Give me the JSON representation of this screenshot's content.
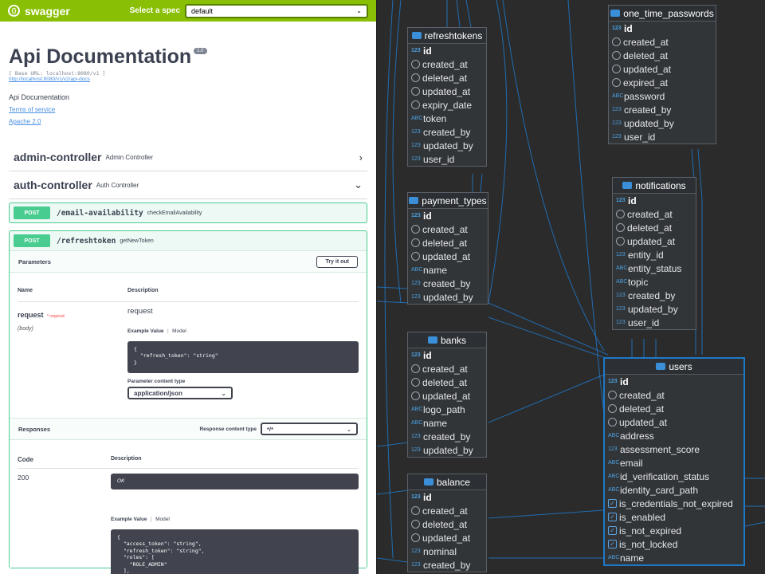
{
  "swagger": {
    "logo": "swagger",
    "select_label": "Select a spec",
    "select_value": "default",
    "title": "Api Documentation",
    "version": "1.0",
    "base_url": "[ Base URL: localhost:8080/v1 ]",
    "docs_link": "http://localhost:8080/v1/v2/api-docs",
    "description": "Api Documentation",
    "terms": "Terms of service",
    "license": "Apache 2.0",
    "controllers": [
      {
        "name": "admin-controller",
        "desc": "Admin Controller",
        "arrow": "›"
      },
      {
        "name": "auth-controller",
        "desc": "Auth Controller",
        "arrow": "⌄"
      }
    ],
    "op1": {
      "method": "POST",
      "path": "/email-availability",
      "summary": "checkEmailAvailability"
    },
    "op2": {
      "method": "POST",
      "path": "/refreshtoken",
      "summary": "getNewToken"
    },
    "parameters_label": "Parameters",
    "try_label": "Try it out",
    "name_col": "Name",
    "desc_col": "Description",
    "param_name": "request",
    "param_required": "* required",
    "param_in": "(body)",
    "param_desc": "request",
    "example_value": "Example Value",
    "model": "Model",
    "example_body": "{\n  \"refresh_token\": \"string\"\n}",
    "content_type_label": "Parameter content type",
    "content_type": "application/json",
    "responses_label": "Responses",
    "response_ct_label": "Response content type",
    "response_ct": "*/*",
    "code_col": "Code",
    "code": "200",
    "ok": "OK",
    "response_body": "{\n  \"access_token\": \"string\",\n  \"refresh_token\": \"string\",\n  \"roles\": [\n    \"ROLE_ADMIN\"\n  ],"
  },
  "er": {
    "refreshtokens": {
      "name": "refreshtokens",
      "cols": [
        [
          "123",
          "id"
        ],
        [
          "clock",
          "created_at"
        ],
        [
          "clock",
          "deleted_at"
        ],
        [
          "clock",
          "updated_at"
        ],
        [
          "clock",
          "expiry_date"
        ],
        [
          "ABC",
          "token"
        ],
        [
          "123",
          "created_by"
        ],
        [
          "123",
          "updated_by"
        ],
        [
          "123",
          "user_id"
        ]
      ]
    },
    "payment_types": {
      "name": "payment_types",
      "cols": [
        [
          "123",
          "id"
        ],
        [
          "clock",
          "created_at"
        ],
        [
          "clock",
          "deleted_at"
        ],
        [
          "clock",
          "updated_at"
        ],
        [
          "ABC",
          "name"
        ],
        [
          "123",
          "created_by"
        ],
        [
          "123",
          "updated_by"
        ]
      ]
    },
    "banks": {
      "name": "banks",
      "cols": [
        [
          "123",
          "id"
        ],
        [
          "clock",
          "created_at"
        ],
        [
          "clock",
          "deleted_at"
        ],
        [
          "clock",
          "updated_at"
        ],
        [
          "ABC",
          "logo_path"
        ],
        [
          "ABC",
          "name"
        ],
        [
          "123",
          "created_by"
        ],
        [
          "123",
          "updated_by"
        ]
      ]
    },
    "balance": {
      "name": "balance",
      "cols": [
        [
          "123",
          "id"
        ],
        [
          "clock",
          "created_at"
        ],
        [
          "clock",
          "deleted_at"
        ],
        [
          "clock",
          "updated_at"
        ],
        [
          "123",
          "nominal"
        ],
        [
          "123",
          "created_by"
        ]
      ]
    },
    "one_time_passwords": {
      "name": "one_time_passwords",
      "cols": [
        [
          "123",
          "id"
        ],
        [
          "clock",
          "created_at"
        ],
        [
          "clock",
          "deleted_at"
        ],
        [
          "clock",
          "updated_at"
        ],
        [
          "clock",
          "expired_at"
        ],
        [
          "ABC",
          "password"
        ],
        [
          "123",
          "created_by"
        ],
        [
          "123",
          "updated_by"
        ],
        [
          "123",
          "user_id"
        ]
      ]
    },
    "notifications": {
      "name": "notifications",
      "cols": [
        [
          "123",
          "id"
        ],
        [
          "clock",
          "created_at"
        ],
        [
          "clock",
          "deleted_at"
        ],
        [
          "clock",
          "updated_at"
        ],
        [
          "123",
          "entity_id"
        ],
        [
          "ABC",
          "entity_status"
        ],
        [
          "ABC",
          "topic"
        ],
        [
          "123",
          "created_by"
        ],
        [
          "123",
          "updated_by"
        ],
        [
          "123",
          "user_id"
        ]
      ]
    },
    "users": {
      "name": "users",
      "cols": [
        [
          "123",
          "id"
        ],
        [
          "clock",
          "created_at"
        ],
        [
          "clock",
          "deleted_at"
        ],
        [
          "clock",
          "updated_at"
        ],
        [
          "ABC",
          "address"
        ],
        [
          "123",
          "assessment_score"
        ],
        [
          "ABC",
          "email"
        ],
        [
          "ABC",
          "id_verification_status"
        ],
        [
          "ABC",
          "identity_card_path"
        ],
        [
          "check",
          "is_credentials_not_expired"
        ],
        [
          "check",
          "is_enabled"
        ],
        [
          "check",
          "is_not_expired"
        ],
        [
          "check",
          "is_not_locked"
        ],
        [
          "ABC",
          "name"
        ]
      ]
    }
  },
  "colors": {
    "swagger_green": "#89bf04",
    "post_green": "#49cc90",
    "er_bg": "#2b2b2b",
    "relation_blue": "#1e78c8"
  }
}
